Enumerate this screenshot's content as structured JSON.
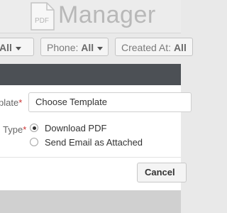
{
  "header": {
    "icon_label": "PDF",
    "title": "Manager"
  },
  "filters": [
    {
      "label": "",
      "value": "All"
    },
    {
      "label": "Phone:",
      "value": "All"
    },
    {
      "label": "Created At:",
      "value": "All"
    }
  ],
  "form": {
    "template_label": "plate",
    "template_value": "Choose Template",
    "type_label": "Type",
    "required_mark": "*",
    "options": [
      {
        "label": "Download PDF",
        "selected": true
      },
      {
        "label": "Send Email as Attached",
        "selected": false
      }
    ]
  },
  "footer": {
    "cancel_label": "Cancel"
  }
}
